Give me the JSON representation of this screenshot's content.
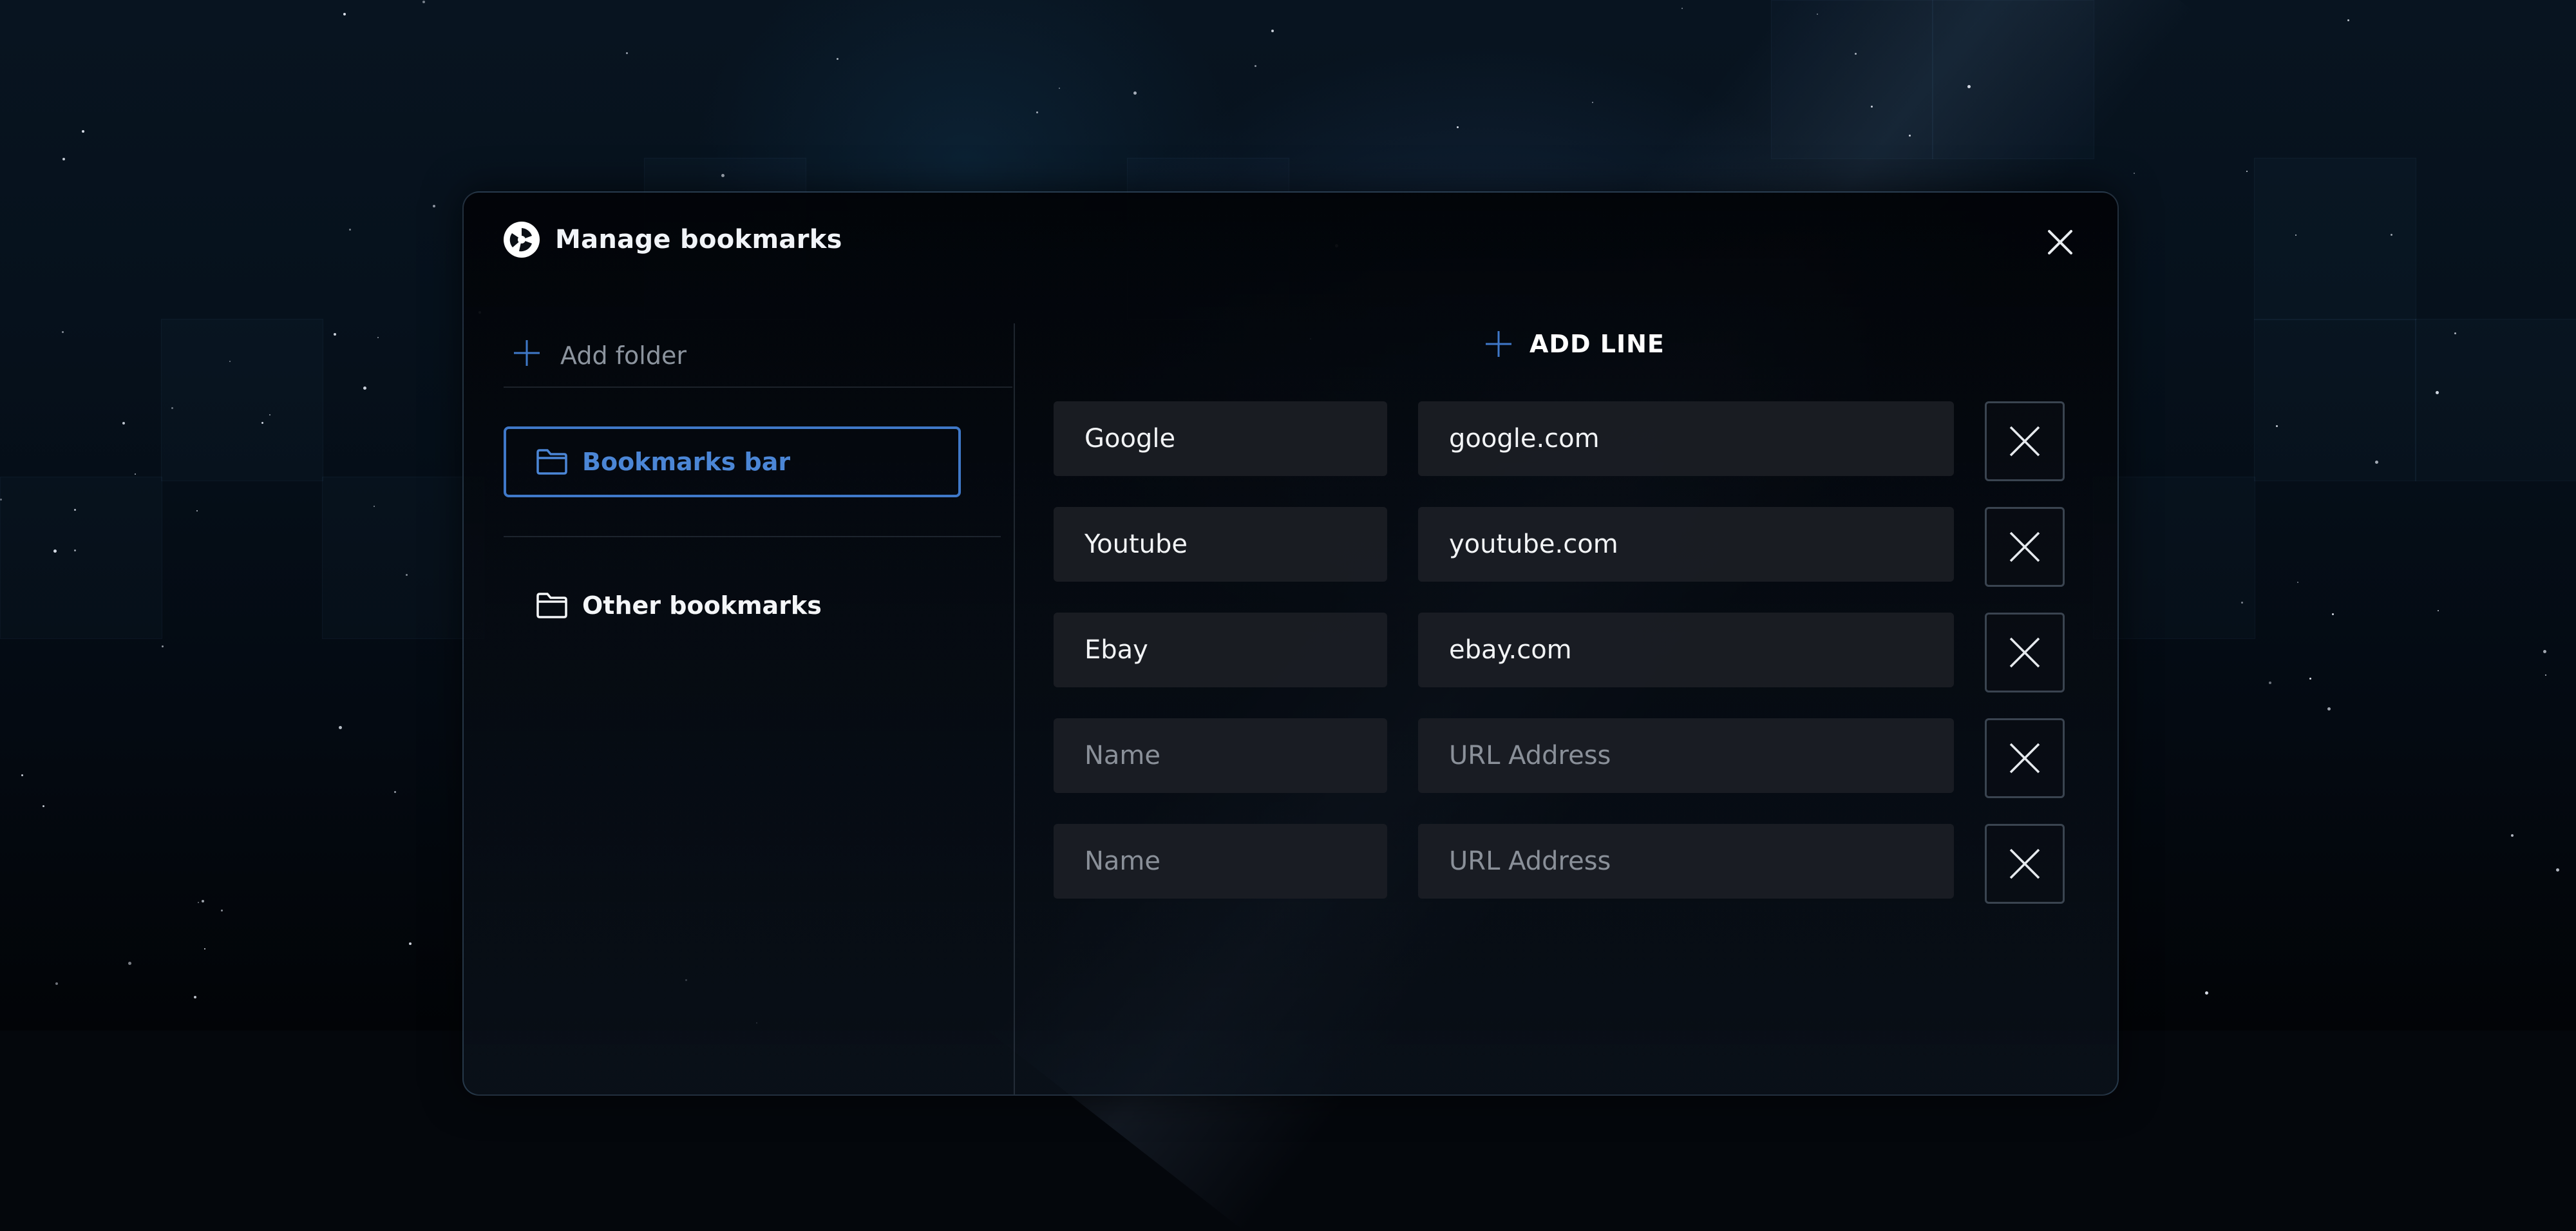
{
  "dialog": {
    "title": "Manage bookmarks",
    "logo_icon": "app-logo-icon",
    "close_icon": "close-icon"
  },
  "folders": {
    "add_label": "Add folder",
    "items": [
      {
        "label": "Bookmarks bar",
        "icon": "folder-icon",
        "selected": true
      },
      {
        "label": "Other bookmarks",
        "icon": "folder-icon",
        "selected": false
      }
    ]
  },
  "bookmarks": {
    "add_line_label": "ADD LINE",
    "rows": [
      {
        "name": "Google",
        "url": "google.com",
        "name_placeholder": "Name",
        "url_placeholder": "URL Address"
      },
      {
        "name": "Youtube",
        "url": "youtube.com",
        "name_placeholder": "Name",
        "url_placeholder": "URL Address"
      },
      {
        "name": "Ebay",
        "url": "ebay.com",
        "name_placeholder": "Name",
        "url_placeholder": "URL Address"
      },
      {
        "name": "",
        "url": "",
        "name_placeholder": "Name",
        "url_placeholder": "URL Address"
      },
      {
        "name": "",
        "url": "",
        "name_placeholder": "Name",
        "url_placeholder": "URL Address"
      }
    ]
  },
  "colors": {
    "accent": "#3f78c8",
    "accent_text": "#4b86d6",
    "input_bg": "#1a1e24",
    "delete_border": "#3a4450"
  }
}
